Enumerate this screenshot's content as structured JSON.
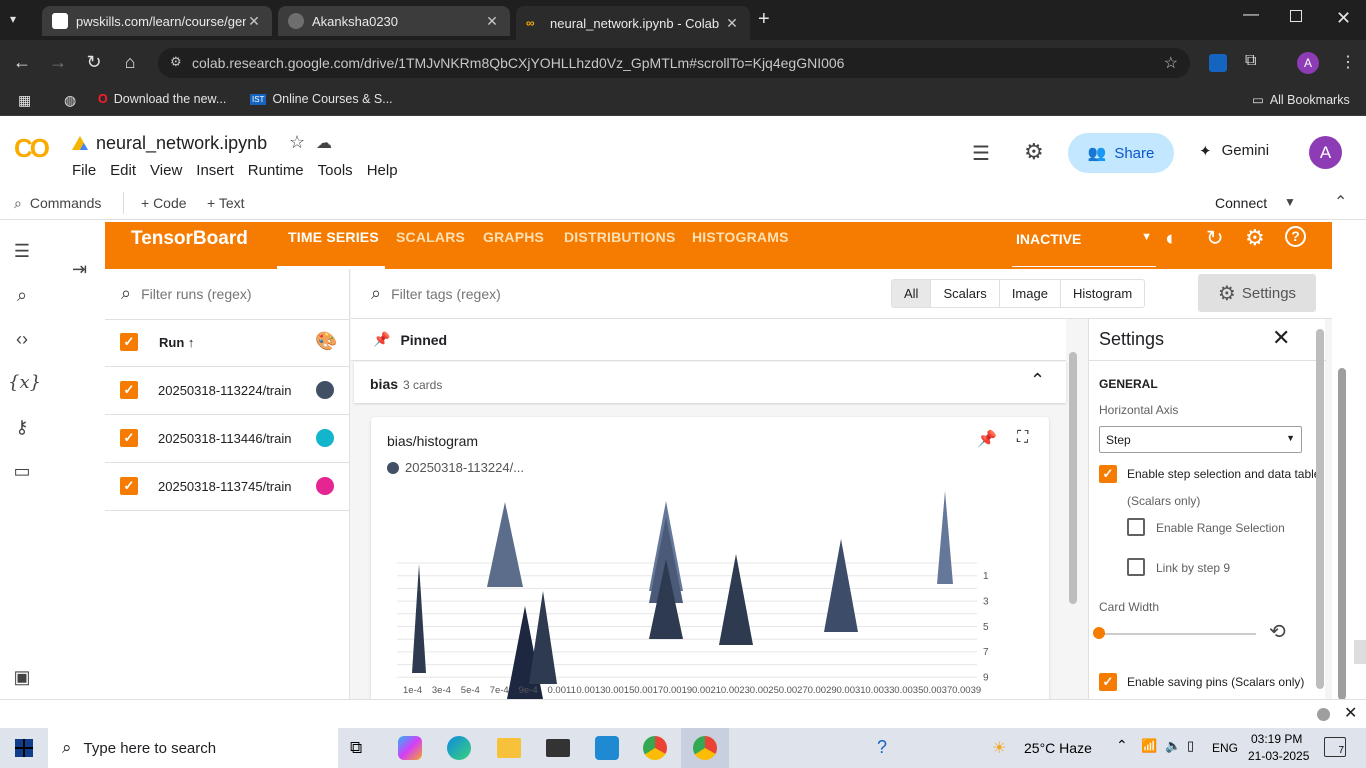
{
  "browser": {
    "tabs": [
      {
        "title": "pwskills.com/learn/course/gena",
        "icon_color": "#1a73e8"
      },
      {
        "title": "Akanksha0230",
        "icon_color": "#6e5494"
      },
      {
        "title": "neural_network.ipynb - Colab",
        "icon_color": "#f9ab00"
      }
    ],
    "url": "colab.research.google.com/drive/1TMJvNKRm8QbCXjYOHLLhzd0Vz_GpMTLm#scrollTo=Kjq4egGNI006",
    "profile_initial": "A",
    "bookmarks": [
      {
        "label": "Download the new..."
      },
      {
        "label": "Online Courses & S..."
      }
    ],
    "all_bookmarks": "All Bookmarks"
  },
  "colab": {
    "notebook_title": "neural_network.ipynb",
    "menu": [
      "File",
      "Edit",
      "View",
      "Insert",
      "Runtime",
      "Tools",
      "Help"
    ],
    "share_label": "Share",
    "gemini_label": "Gemini",
    "avatar": "A",
    "commands_label": "Commands",
    "code_label": "+ Code",
    "text_label": "+ Text",
    "connect_label": "Connect"
  },
  "tensorboard": {
    "brand": "TensorBoard",
    "tabs": [
      "TIME SERIES",
      "SCALARS",
      "GRAPHS",
      "DISTRIBUTIONS",
      "HISTOGRAMS"
    ],
    "status": "INACTIVE",
    "filter_runs_placeholder": "Filter runs (regex)",
    "filter_tags_placeholder": "Filter tags (regex)",
    "tag_filters": [
      "All",
      "Scalars",
      "Image",
      "Histogram"
    ],
    "settings_button": "Settings",
    "runs_header": "Run ↑",
    "runs": [
      {
        "name": "20250318-113224/train",
        "color": "#425066"
      },
      {
        "name": "20250318-113446/train",
        "color": "#12b5cb"
      },
      {
        "name": "20250318-113745/train",
        "color": "#e52592"
      }
    ],
    "pinned_label": "Pinned",
    "group_name": "bias",
    "group_count": "3 cards",
    "card_title": "bias/histogram",
    "card_run": "20250318-113224/...",
    "settings_panel": {
      "title": "Settings",
      "section": "GENERAL",
      "horizontal_axis_label": "Horizontal Axis",
      "horizontal_axis_value": "Step",
      "enable_step": "Enable step selection and data table",
      "scalars_only": "(Scalars only)",
      "enable_range": "Enable Range Selection",
      "link_by_step": "Link by step 9",
      "card_width": "Card Width",
      "enable_saving_pins": "Enable saving pins (Scalars only)"
    }
  },
  "chart_data": {
    "type": "histogram",
    "x_tick_labels": [
      "1e-4",
      "3e-4",
      "5e-4",
      "7e-4",
      "9e-4",
      "0.0011",
      "0.0013",
      "0.0015",
      "0.0017",
      "0.0019",
      "0.0021",
      "0.0023",
      "0.0025",
      "0.0027",
      "0.0029",
      "0.0031",
      "0.0033",
      "0.0035",
      "0.0037",
      "0.0039"
    ],
    "y_tick_labels": [
      "1",
      "3",
      "5",
      "7",
      "9"
    ]
  },
  "taskbar": {
    "search_placeholder": "Type here to search",
    "weather": "25°C  Haze",
    "lang": "ENG",
    "time": "03:19 PM",
    "date": "21-03-2025",
    "notif": "7"
  }
}
